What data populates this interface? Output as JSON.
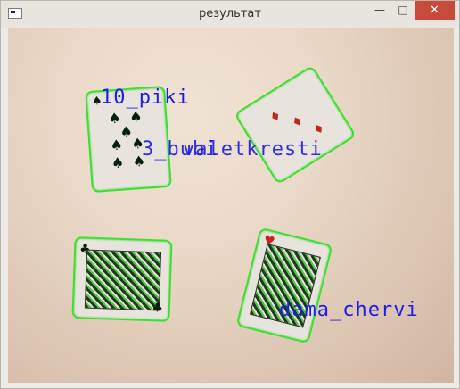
{
  "window": {
    "title": "результат"
  },
  "controls": {
    "minimize": "—",
    "maximize": "□",
    "close": "✕"
  },
  "detections": [
    {
      "label": "10_piki"
    },
    {
      "label": "3_bubi"
    },
    {
      "label": "valetkresti"
    },
    {
      "label": "dama_chervi"
    }
  ],
  "colors": {
    "detection_box": "#3de02e",
    "label_text": "#1d1de8",
    "close_button": "#c74a3a"
  },
  "icons": {
    "app": "window-icon",
    "minimize": "minimize-icon",
    "maximize": "maximize-icon",
    "close": "close-icon"
  }
}
